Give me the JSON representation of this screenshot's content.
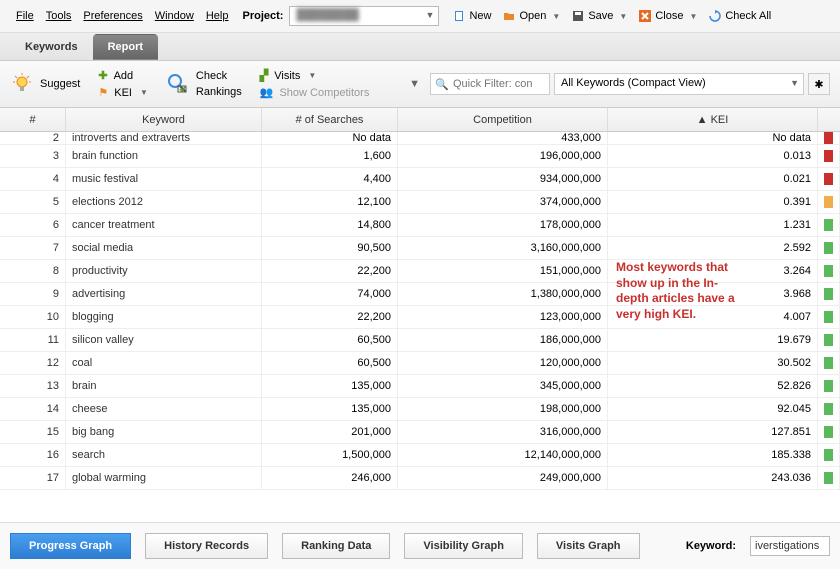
{
  "menu": {
    "file": "File",
    "tools": "Tools",
    "preferences": "Preferences",
    "window": "Window",
    "help": "Help",
    "project_label": "Project:"
  },
  "menubar_right": {
    "new": "New",
    "open": "Open",
    "save": "Save",
    "close": "Close",
    "check_all": "Check All"
  },
  "tabs": {
    "keywords": "Keywords",
    "report": "Report"
  },
  "toolbar": {
    "suggest": "Suggest",
    "add": "Add",
    "kei": "KEI",
    "check_rankings1": "Check",
    "check_rankings2": "Rankings",
    "visits": "Visits",
    "show_competitors": "Show Competitors",
    "filter_placeholder": "Quick Filter: con",
    "view_select": "All Keywords (Compact View)"
  },
  "columns": {
    "num": "#",
    "keyword": "Keyword",
    "searches": "# of Searches",
    "competition": "Competition",
    "kei": "▲ KEI"
  },
  "rows": [
    {
      "n": "2",
      "kw": "introverts and extraverts",
      "s": "No data",
      "c": "433,000",
      "k": "No data",
      "color": "red"
    },
    {
      "n": "3",
      "kw": "brain function",
      "s": "1,600",
      "c": "196,000,000",
      "k": "0.013",
      "color": "red"
    },
    {
      "n": "4",
      "kw": "music festival",
      "s": "4,400",
      "c": "934,000,000",
      "k": "0.021",
      "color": "red"
    },
    {
      "n": "5",
      "kw": "elections 2012",
      "s": "12,100",
      "c": "374,000,000",
      "k": "0.391",
      "color": "orange"
    },
    {
      "n": "6",
      "kw": "cancer treatment",
      "s": "14,800",
      "c": "178,000,000",
      "k": "1.231",
      "color": "green"
    },
    {
      "n": "7",
      "kw": "social media",
      "s": "90,500",
      "c": "3,160,000,000",
      "k": "2.592",
      "color": "green"
    },
    {
      "n": "8",
      "kw": "productivity",
      "s": "22,200",
      "c": "151,000,000",
      "k": "3.264",
      "color": "green"
    },
    {
      "n": "9",
      "kw": "advertising",
      "s": "74,000",
      "c": "1,380,000,000",
      "k": "3.968",
      "color": "green"
    },
    {
      "n": "10",
      "kw": "blogging",
      "s": "22,200",
      "c": "123,000,000",
      "k": "4.007",
      "color": "green"
    },
    {
      "n": "11",
      "kw": "silicon valley",
      "s": "60,500",
      "c": "186,000,000",
      "k": "19.679",
      "color": "green"
    },
    {
      "n": "12",
      "kw": "coal",
      "s": "60,500",
      "c": "120,000,000",
      "k": "30.502",
      "color": "green"
    },
    {
      "n": "13",
      "kw": "brain",
      "s": "135,000",
      "c": "345,000,000",
      "k": "52.826",
      "color": "green"
    },
    {
      "n": "14",
      "kw": "cheese",
      "s": "135,000",
      "c": "198,000,000",
      "k": "92.045",
      "color": "green"
    },
    {
      "n": "15",
      "kw": "big bang",
      "s": "201,000",
      "c": "316,000,000",
      "k": "127.851",
      "color": "green"
    },
    {
      "n": "16",
      "kw": "search",
      "s": "1,500,000",
      "c": "12,140,000,000",
      "k": "185.338",
      "color": "green"
    },
    {
      "n": "17",
      "kw": "global warming",
      "s": "246,000",
      "c": "249,000,000",
      "k": "243.036",
      "color": "green"
    }
  ],
  "annotation": "Most keywords that show up in the In-depth articles have a very high KEI.",
  "bottom": {
    "progress": "Progress Graph",
    "history": "History Records",
    "ranking": "Ranking Data",
    "visibility": "Visibility Graph",
    "visits": "Visits Graph",
    "kw_label": "Keyword:",
    "kw_value": "iverstigations"
  },
  "chart_data": {
    "type": "table",
    "title": "Keyword KEI Rankings",
    "columns": [
      "#",
      "Keyword",
      "# of Searches",
      "Competition",
      "KEI"
    ],
    "rows": [
      [
        2,
        "introverts and extraverts",
        null,
        433000,
        null
      ],
      [
        3,
        "brain function",
        1600,
        196000000,
        0.013
      ],
      [
        4,
        "music festival",
        4400,
        934000000,
        0.021
      ],
      [
        5,
        "elections 2012",
        12100,
        374000000,
        0.391
      ],
      [
        6,
        "cancer treatment",
        14800,
        178000000,
        1.231
      ],
      [
        7,
        "social media",
        90500,
        3160000000,
        2.592
      ],
      [
        8,
        "productivity",
        22200,
        151000000,
        3.264
      ],
      [
        9,
        "advertising",
        74000,
        1380000000,
        3.968
      ],
      [
        10,
        "blogging",
        22200,
        123000000,
        4.007
      ],
      [
        11,
        "silicon valley",
        60500,
        186000000,
        19.679
      ],
      [
        12,
        "coal",
        60500,
        120000000,
        30.502
      ],
      [
        13,
        "brain",
        135000,
        345000000,
        52.826
      ],
      [
        14,
        "cheese",
        135000,
        198000000,
        92.045
      ],
      [
        15,
        "big bang",
        201000,
        316000000,
        127.851
      ],
      [
        16,
        "search",
        1500000,
        12140000000,
        185.338
      ],
      [
        17,
        "global warming",
        246000,
        249000000,
        243.036
      ]
    ]
  }
}
